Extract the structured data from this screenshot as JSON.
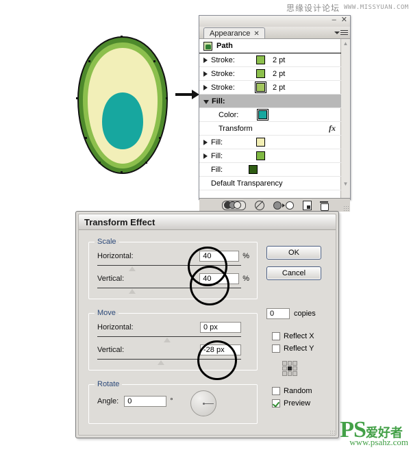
{
  "watermarks": {
    "top_cn": "思缘设计论坛",
    "top_url": "WWW.MISSYUAN.COM",
    "bottom_ps": "PS",
    "bottom_cn": "爱好者",
    "bottom_url": "www.psahz.com"
  },
  "artwork": {
    "name": "avocado-illustration",
    "outer_color": "#4e8a2c",
    "mid_color": "#8cbf4d",
    "flesh_color": "#f2efb8",
    "pit_color": "#17a79f"
  },
  "panel": {
    "tab_label": "Appearance",
    "tab_close": "✕",
    "minimize": "–",
    "close": "✕",
    "target_label": "Path",
    "rows": [
      {
        "label": "Stroke:",
        "value": "2 pt",
        "swatch": "#8cbf4d",
        "disclosure": "closed",
        "indent": false,
        "selected": false,
        "double": false
      },
      {
        "label": "Stroke:",
        "value": "2 pt",
        "swatch": "#8cbf4d",
        "disclosure": "closed",
        "indent": false,
        "selected": false,
        "double": false
      },
      {
        "label": "Stroke:",
        "value": "2 pt",
        "swatch": "#a3c65e",
        "disclosure": "closed",
        "indent": false,
        "selected": false,
        "double": true
      },
      {
        "label": "Fill:",
        "value": "",
        "swatch": "",
        "disclosure": "open",
        "indent": false,
        "selected": true,
        "double": false
      },
      {
        "label": "Color:",
        "value": "",
        "swatch": "#17a79f",
        "disclosure": "none",
        "indent": true,
        "selected": false,
        "double": true
      },
      {
        "label": "Transform",
        "value": "",
        "swatch": "",
        "disclosure": "none",
        "indent": true,
        "selected": false,
        "double": false,
        "fx": "fx"
      },
      {
        "label": "Fill:",
        "value": "",
        "swatch": "#f2eeb4",
        "disclosure": "closed",
        "indent": false,
        "selected": false,
        "double": false
      },
      {
        "label": "Fill:",
        "value": "",
        "swatch": "#7fb843",
        "disclosure": "closed",
        "indent": false,
        "selected": false,
        "double": false
      },
      {
        "label": "Fill:",
        "value": "",
        "swatch": "#2f5c13",
        "disclosure": "none",
        "indent": false,
        "selected": false,
        "double": false
      },
      {
        "label": "Default Transparency",
        "value": "",
        "swatch": "",
        "disclosure": "none",
        "indent": false,
        "selected": false,
        "double": false
      }
    ],
    "footer_icons": [
      "visibility-toggle-icon",
      "clear-appearance-icon",
      "reduce-to-basic-appearance-icon",
      "duplicate-item-icon",
      "delete-item-icon"
    ]
  },
  "dialog": {
    "title": "Transform Effect",
    "scale": {
      "legend": "Scale",
      "horizontal_label": "Horizontal:",
      "horizontal_value": "40",
      "horizontal_unit": "%",
      "horizontal_slider_pct": 22,
      "vertical_label": "Vertical:",
      "vertical_value": "40",
      "vertical_unit": "%",
      "vertical_slider_pct": 22
    },
    "move": {
      "legend": "Move",
      "horizontal_label": "Horizontal:",
      "horizontal_value": "0 px",
      "horizontal_slider_pct": 46,
      "vertical_label": "Vertical:",
      "vertical_value": "-28 px",
      "vertical_slider_pct": 42
    },
    "rotate": {
      "legend": "Rotate",
      "angle_label": "Angle:",
      "angle_value": "0",
      "angle_unit": "°"
    },
    "buttons": {
      "ok": "OK",
      "cancel": "Cancel"
    },
    "copies_value": "0",
    "copies_label": "copies",
    "checkboxes": [
      {
        "label": "Reflect X",
        "checked": false
      },
      {
        "label": "Reflect Y",
        "checked": false
      },
      {
        "label": "Random",
        "checked": false
      },
      {
        "label": "Preview",
        "checked": true
      }
    ],
    "anchor_label": "anchor-point-selector"
  },
  "highlights": [
    {
      "name": "scale-horizontal-highlight"
    },
    {
      "name": "scale-vertical-highlight"
    },
    {
      "name": "move-vertical-highlight"
    }
  ]
}
